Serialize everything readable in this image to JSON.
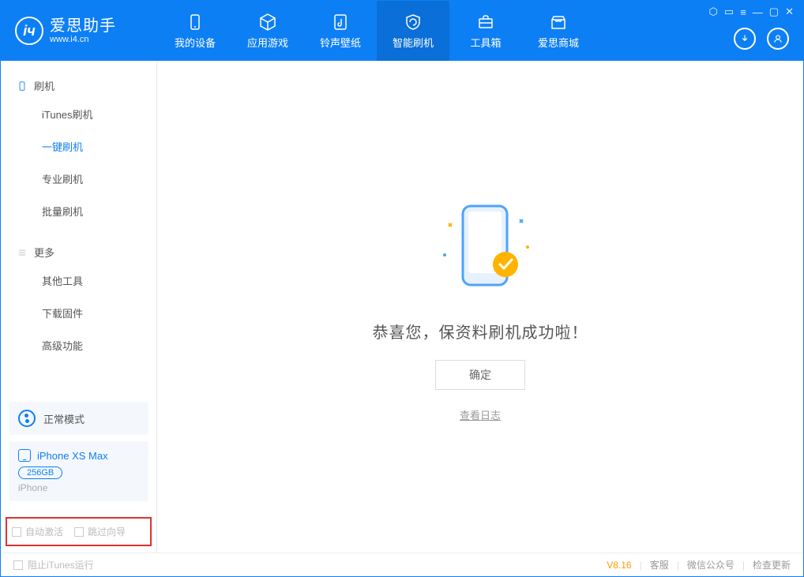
{
  "app": {
    "name": "爱思助手",
    "site": "www.i4.cn"
  },
  "nav": {
    "0": {
      "label": "我的设备"
    },
    "1": {
      "label": "应用游戏"
    },
    "2": {
      "label": "铃声壁纸"
    },
    "3": {
      "label": "智能刷机"
    },
    "4": {
      "label": "工具箱"
    },
    "5": {
      "label": "爱思商城"
    }
  },
  "sidebar": {
    "group1": {
      "title": "刷机",
      "items": {
        "0": "iTunes刷机",
        "1": "一键刷机",
        "2": "专业刷机",
        "3": "批量刷机"
      }
    },
    "group2": {
      "title": "更多",
      "items": {
        "0": "其他工具",
        "1": "下载固件",
        "2": "高级功能"
      }
    },
    "mode": {
      "label": "正常模式"
    },
    "device": {
      "name": "iPhone XS Max",
      "capacity": "256GB",
      "type": "iPhone"
    },
    "checks": {
      "autoActivate": "自动激活",
      "skipGuide": "跳过向导"
    }
  },
  "main": {
    "successTitle": "恭喜您，保资料刷机成功啦！",
    "okButton": "确定",
    "viewLog": "查看日志"
  },
  "footer": {
    "blockItunes": "阻止iTunes运行",
    "version": "V8.16",
    "support": "客服",
    "wechat": "微信公众号",
    "checkUpdate": "检查更新"
  }
}
